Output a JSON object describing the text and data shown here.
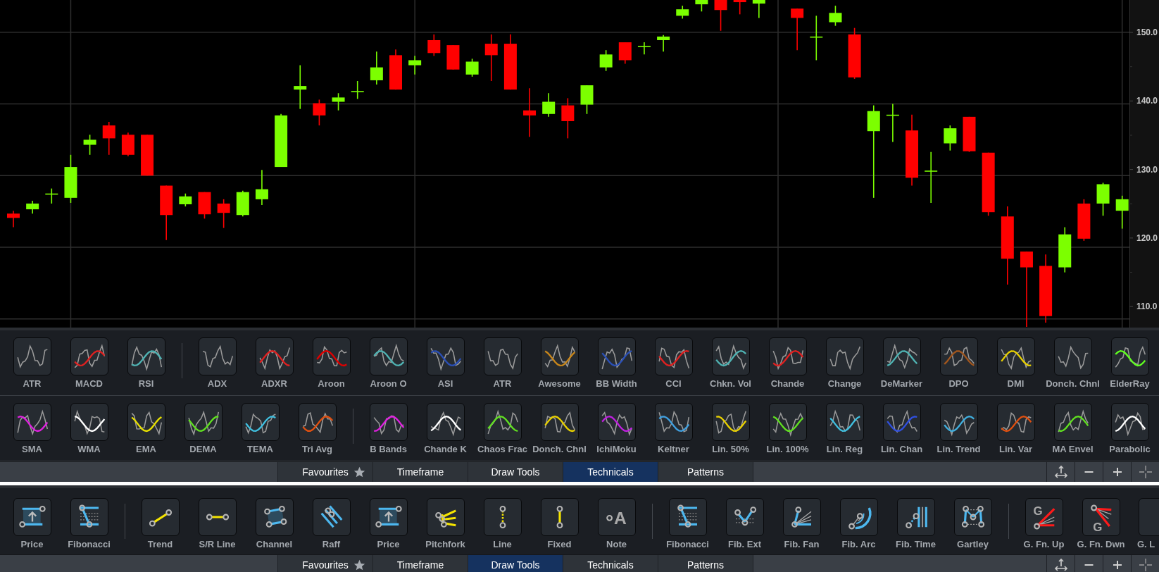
{
  "chart": {
    "y_axis": {
      "labels": [
        "150.0",
        "140.0",
        "130.0",
        "120.0",
        "110.0"
      ]
    }
  },
  "technicals_panel": {
    "rows": [
      {
        "tools": [
          {
            "kind": "tool",
            "label": "ATR"
          },
          {
            "kind": "tool",
            "label": "MACD",
            "color": "#e02020"
          },
          {
            "kind": "tool",
            "label": "RSI",
            "color": "#4fb3b3"
          },
          {
            "kind": "separator"
          },
          {
            "kind": "tool",
            "label": "ADX"
          },
          {
            "kind": "tool",
            "label": "ADXR",
            "color": "#e02020"
          },
          {
            "kind": "tool",
            "label": "Aroon",
            "color": "#e00000"
          },
          {
            "kind": "tool",
            "label": "Aroon O",
            "color": "#4fb3b3"
          },
          {
            "kind": "tool",
            "label": "ASI",
            "color": "#2a4fb5"
          },
          {
            "kind": "tool",
            "label": "ATR"
          },
          {
            "kind": "tool",
            "label": "Awesome",
            "color": "#c8861a"
          },
          {
            "kind": "tool",
            "label": "BB Width",
            "color": "#2a4fb5"
          },
          {
            "kind": "tool",
            "label": "CCI",
            "color": "#e02020"
          },
          {
            "kind": "tool",
            "label": "Chkn. Vol",
            "color": "#4fb3b3"
          },
          {
            "kind": "tool",
            "label": "Chande",
            "color": "#e02020"
          },
          {
            "kind": "tool",
            "label": "Change"
          },
          {
            "kind": "tool",
            "label": "DeMarker",
            "color": "#4fb3b3"
          },
          {
            "kind": "tool",
            "label": "DPO",
            "color": "#a0561e"
          },
          {
            "kind": "tool",
            "label": "DMI",
            "color": "#e8d000"
          },
          {
            "kind": "tool",
            "label": "Donch. Chnl"
          },
          {
            "kind": "tool",
            "label": "ElderRay",
            "color": "#60ff20"
          }
        ]
      },
      {
        "tools": [
          {
            "kind": "tool",
            "label": "SMA",
            "color": "#e020e0"
          },
          {
            "kind": "tool",
            "label": "WMA",
            "color": "#ffffff"
          },
          {
            "kind": "tool",
            "label": "EMA",
            "color": "#e8e000"
          },
          {
            "kind": "tool",
            "label": "DEMA",
            "color": "#60e020"
          },
          {
            "kind": "tool",
            "label": "TEMA",
            "color": "#40c0e0"
          },
          {
            "kind": "tool",
            "label": "Tri Avg",
            "color": "#e05010"
          },
          {
            "kind": "separator"
          },
          {
            "kind": "tool",
            "label": "B Bands",
            "color": "#e020e0"
          },
          {
            "kind": "tool",
            "label": "Chande K",
            "color": "#ffffff"
          },
          {
            "kind": "tool",
            "label": "Chaos Frac",
            "color": "#60e020"
          },
          {
            "kind": "tool",
            "label": "Donch. Chnl",
            "color": "#e8d000"
          },
          {
            "kind": "tool",
            "label": "IchiMoku",
            "color": "#c020e0"
          },
          {
            "kind": "tool",
            "label": "Keltner",
            "color": "#40a0e0"
          },
          {
            "kind": "tool",
            "label": "Lin. 50%",
            "color": "#e8d000"
          },
          {
            "kind": "tool",
            "label": "Lin. 100%",
            "color": "#60e020"
          },
          {
            "kind": "tool",
            "label": "Lin. Reg",
            "color": "#40c0e0"
          },
          {
            "kind": "tool",
            "label": "Lin. Chan",
            "color": "#3050e0"
          },
          {
            "kind": "tool",
            "label": "Lin. Trend",
            "color": "#40b0e0"
          },
          {
            "kind": "tool",
            "label": "Lin. Var",
            "color": "#e05010"
          },
          {
            "kind": "tool",
            "label": "MA Envel",
            "color": "#60e020"
          },
          {
            "kind": "tool",
            "label": "Parabolic",
            "color": "#ffffff"
          }
        ]
      }
    ],
    "tab_bar": {
      "tabs": [
        {
          "kind": "favourites",
          "label": "Favourites",
          "selected": false
        },
        {
          "kind": "plain",
          "label": "Timeframe",
          "selected": false
        },
        {
          "kind": "plain",
          "label": "Draw Tools",
          "selected": false
        },
        {
          "kind": "plain",
          "label": "Technicals",
          "selected": true
        },
        {
          "kind": "plain",
          "label": "Patterns",
          "selected": false
        }
      ]
    }
  },
  "draw_tools_panel": {
    "rows": [
      {
        "tools": [
          {
            "kind": "tool",
            "label": "Price"
          },
          {
            "kind": "tool",
            "label": "Fibonacci"
          },
          {
            "kind": "separator"
          },
          {
            "kind": "tool",
            "label": "Trend"
          },
          {
            "kind": "tool",
            "label": "S/R Line"
          },
          {
            "kind": "tool",
            "label": "Channel"
          },
          {
            "kind": "tool",
            "label": "Raff"
          },
          {
            "kind": "tool",
            "label": "Price"
          },
          {
            "kind": "tool",
            "label": "Pitchfork"
          },
          {
            "kind": "tool",
            "label": "Line"
          },
          {
            "kind": "tool",
            "label": "Fixed"
          },
          {
            "kind": "tool",
            "label": "Note",
            "glyph": "A"
          },
          {
            "kind": "separator"
          },
          {
            "kind": "tool",
            "label": "Fibonacci"
          },
          {
            "kind": "tool",
            "label": "Fib. Ext"
          },
          {
            "kind": "tool",
            "label": "Fib. Fan"
          },
          {
            "kind": "tool",
            "label": "Fib. Arc"
          },
          {
            "kind": "tool",
            "label": "Fib. Time"
          },
          {
            "kind": "tool",
            "label": "Gartley"
          },
          {
            "kind": "separator"
          },
          {
            "kind": "tool",
            "label": "G. Fn. Up",
            "glyph": "G"
          },
          {
            "kind": "tool",
            "label": "G. Fn. Dwn",
            "glyph": "G"
          },
          {
            "kind": "partial",
            "label": "G. L"
          }
        ]
      }
    ],
    "tab_bar": {
      "tabs": [
        {
          "kind": "favourites",
          "label": "Favourites",
          "selected": false
        },
        {
          "kind": "plain",
          "label": "Timeframe",
          "selected": false
        },
        {
          "kind": "plain",
          "label": "Draw Tools",
          "selected": true
        },
        {
          "kind": "plain",
          "label": "Technicals",
          "selected": false
        },
        {
          "kind": "plain",
          "label": "Patterns",
          "selected": false
        }
      ]
    }
  }
}
